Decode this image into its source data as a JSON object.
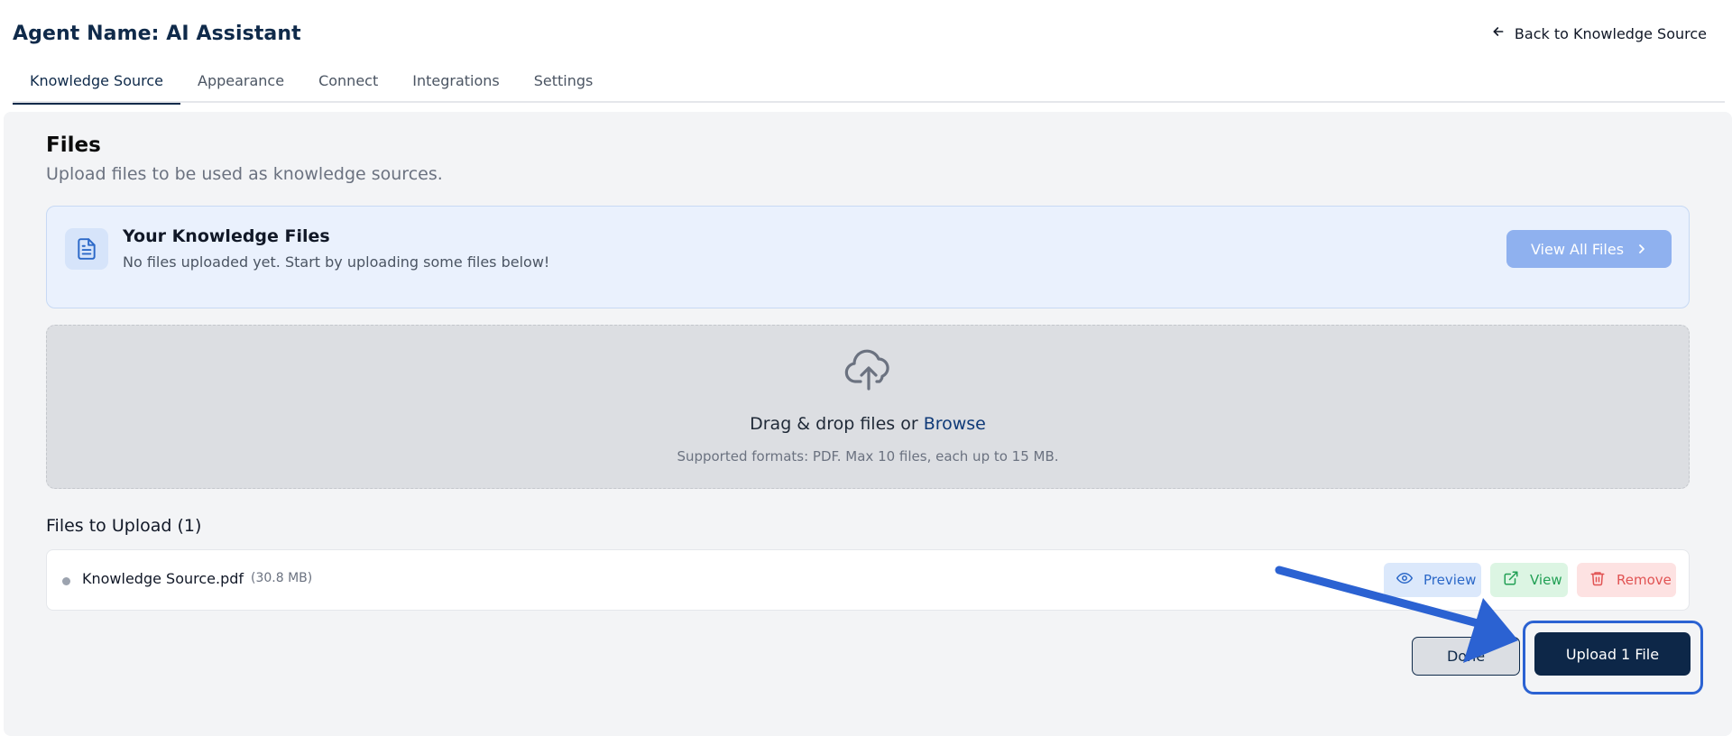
{
  "header": {
    "agent_title": "Agent Name: AI Assistant",
    "back_label": "Back to Knowledge Source",
    "back_icon": "arrow-left-icon"
  },
  "tabs": [
    {
      "label": "Knowledge Source",
      "active": true
    },
    {
      "label": "Appearance",
      "active": false
    },
    {
      "label": "Connect",
      "active": false
    },
    {
      "label": "Integrations",
      "active": false
    },
    {
      "label": "Settings",
      "active": false
    }
  ],
  "files_section": {
    "title": "Files",
    "subtitle": "Upload files to be used as knowledge sources."
  },
  "knowledge_card": {
    "icon": "document-icon",
    "title": "Your Knowledge Files",
    "subtitle": "No files uploaded yet. Start by uploading some files below!",
    "view_all_label": "View All Files"
  },
  "dropzone": {
    "icon": "cloud-upload-icon",
    "text": "Drag & drop files or",
    "browse_label": "Browse",
    "hint": "Supported formats: PDF. Max 10 files, each up to 15 MB."
  },
  "upload_list": {
    "title": "Files to Upload (1)",
    "files": [
      {
        "name": "Knowledge Source.pdf",
        "size": "(30.8 MB)",
        "actions": {
          "preview_label": "Preview",
          "view_label": "View",
          "remove_label": "Remove"
        }
      }
    ]
  },
  "footer": {
    "done_label": "Done",
    "upload_label": "Upload 1 File"
  },
  "colors": {
    "brand_navy": "#0d2748",
    "annotation_blue": "#2b62d2",
    "preview_blue": "#2b68c8",
    "view_green": "#22a055",
    "remove_red": "#e15353"
  }
}
